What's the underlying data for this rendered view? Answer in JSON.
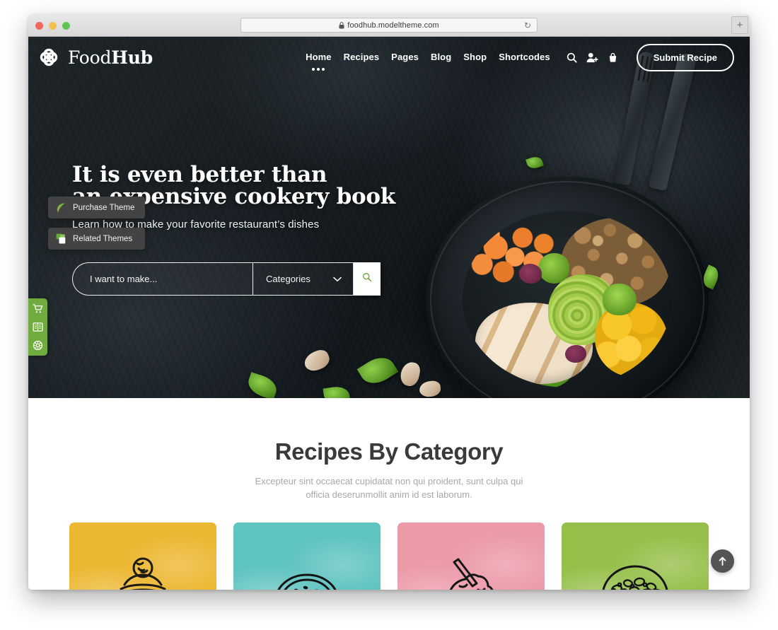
{
  "browser": {
    "url": "foodhub.modeltheme.com",
    "lock_icon": "lock-icon",
    "reload_icon": "reload-icon",
    "new_tab_label": "+",
    "traffic_lights": [
      "close",
      "minimize",
      "zoom"
    ]
  },
  "header": {
    "logo": {
      "icon": "knot-logo-icon",
      "text_light": "Food",
      "text_bold": "Hub"
    },
    "nav": [
      {
        "label": "Home",
        "active": true
      },
      {
        "label": "Recipes",
        "active": false
      },
      {
        "label": "Pages",
        "active": false
      },
      {
        "label": "Blog",
        "active": false
      },
      {
        "label": "Shop",
        "active": false
      },
      {
        "label": "Shortcodes",
        "active": false
      }
    ],
    "icons": [
      {
        "name": "search-icon"
      },
      {
        "name": "user-add-icon"
      },
      {
        "name": "cart-icon"
      }
    ],
    "submit_button": "Submit Recipe"
  },
  "hero": {
    "title_line1": "It is even better than",
    "title_line2": "an expensive cookery book",
    "subtitle": "Learn how to make your favorite restaurant’s dishes",
    "search": {
      "placeholder": "I want to make...",
      "category_label": "Categories",
      "category_chevron": "chevron-down-icon",
      "submit_icon": "search-icon",
      "accent_color": "#6fab3f"
    }
  },
  "side_dock": {
    "accent_color": "#6fab3f",
    "items": [
      {
        "name": "cart-icon"
      },
      {
        "name": "recipe-book-icon"
      },
      {
        "name": "settings-wheel-icon"
      }
    ]
  },
  "content": {
    "section_title": "Recipes By Category",
    "section_subtitle": "Excepteur sint occaecat cupidatat non qui proident, sunt culpa qui officia deserunmollit anim id est laborum.",
    "cards": [
      {
        "name": "category-card-dessert",
        "color": "#ecb731",
        "art": "cupcake"
      },
      {
        "name": "category-card-bakery",
        "color": "#5fc3bf",
        "art": "bread"
      },
      {
        "name": "category-card-drinks",
        "color": "#ec9aa8",
        "art": "milkshake"
      },
      {
        "name": "category-card-salad",
        "color": "#96bf4a",
        "art": "salad"
      }
    ]
  },
  "overlays": {
    "badges": [
      {
        "label": "Purchase Theme",
        "icon": "envato-leaf-icon"
      },
      {
        "label": "Related Themes",
        "icon": "related-themes-icon"
      }
    ],
    "scroll_top": {
      "name": "scroll-to-top-button",
      "glyph": "↑"
    }
  }
}
